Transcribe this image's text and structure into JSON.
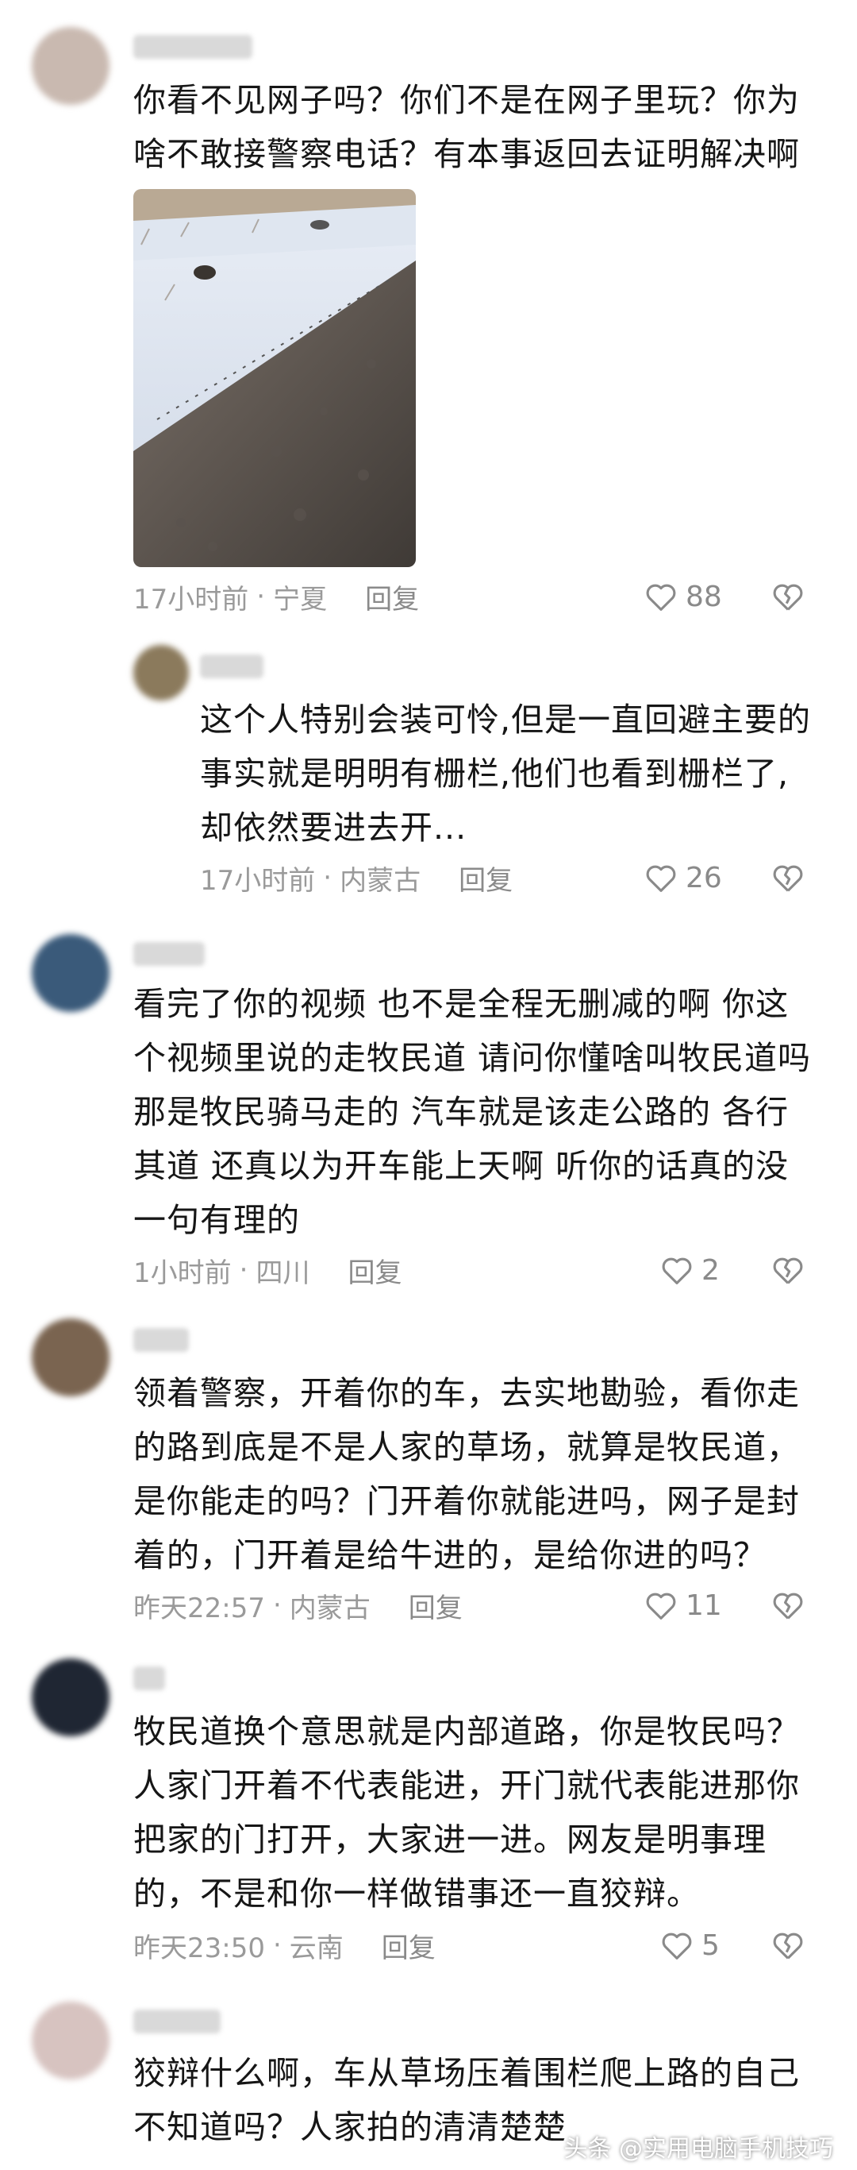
{
  "comments": [
    {
      "text_lines": [
        "你看不见网子吗？你们不是在网子里玩？你为",
        "啥不敢接警察电话？有本事返回去证明解决啊"
      ],
      "time": "17小时前",
      "location": "宁夏",
      "reply_label": "回复",
      "likes": "88",
      "avatar_color": "#c9b9b0"
    },
    {
      "text_lines": [
        "这个人特别会装可怜,但是一直回避主要的",
        "事实就是明明有栅栏,他们也看到栅栏了,",
        "却依然要进去开..."
      ],
      "time": "17小时前",
      "location": "内蒙古",
      "reply_label": "回复",
      "likes": "26",
      "avatar_color": "#8b7a5c"
    },
    {
      "text_lines": [
        "看完了你的视频 也不是全程无删减的啊 你这",
        "个视频里说的走牧民道 请问你懂啥叫牧民道吗",
        "那是牧民骑马走的 汽车就是该走公路的 各行",
        "其道 还真以为开车能上天啊 听你的话真的没",
        "一句有理的"
      ],
      "time": "1小时前",
      "location": "四川",
      "reply_label": "回复",
      "likes": "2",
      "avatar_color": "#3a5a7a"
    },
    {
      "text_lines": [
        "领着警察，开着你的车，去实地勘验，看你走",
        "的路到底是不是人家的草场，就算是牧民道，",
        "是你能走的吗？门开着你就能进吗，网子是封",
        "着的，门开着是给牛进的，是给你进的吗？"
      ],
      "time": "昨天22:57",
      "location": "内蒙古",
      "reply_label": "回复",
      "likes": "11",
      "avatar_color": "#7a6450"
    },
    {
      "text_lines": [
        "牧民道换个意思就是内部道路，你是牧民吗？",
        "人家门开着不代表能进，开门就代表能进那你",
        "把家的门打开，大家进一进。网友是明事理",
        "的，不是和你一样做错事还一直狡辩。"
      ],
      "time": "昨天23:50",
      "location": "云南",
      "reply_label": "回复",
      "likes": "5",
      "avatar_color": "#1f2633"
    },
    {
      "text_lines": [
        "狡辩什么啊，车从草场压着围栏爬上路的自己",
        "不知道吗？人家拍的清清楚楚"
      ],
      "avatar_color": "#d7c3c0"
    }
  ],
  "separator": "·",
  "watermark": "头条 @实用电脑手机技巧",
  "colors": {
    "like_icon": "#8a8a8a",
    "meta_text": "#9a9a9a"
  }
}
